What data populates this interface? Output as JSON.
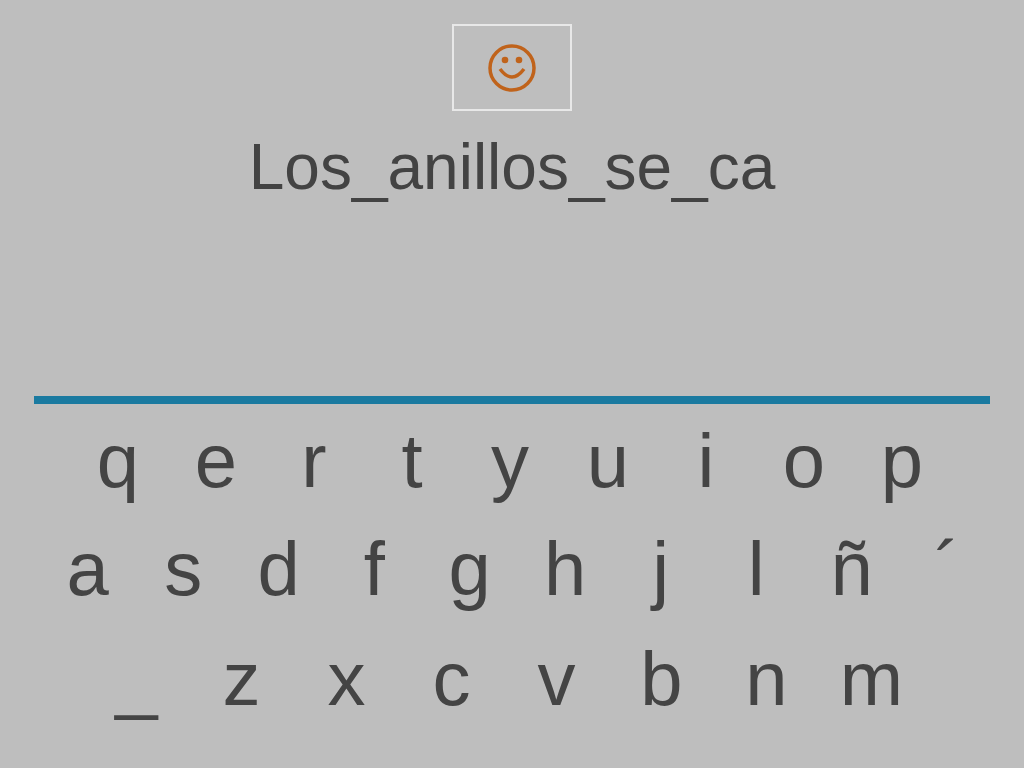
{
  "answer": "Los_anillos_se_ca",
  "keyboard": {
    "rows": [
      [
        "q",
        "e",
        "r",
        "t",
        "y",
        "u",
        "i",
        "o",
        "p"
      ],
      [
        "a",
        "s",
        "d",
        "f",
        "g",
        "h",
        "j",
        "l",
        "ñ",
        "´"
      ],
      [
        "_",
        "z",
        "x",
        "c",
        "v",
        "b",
        "n",
        "m"
      ]
    ]
  }
}
